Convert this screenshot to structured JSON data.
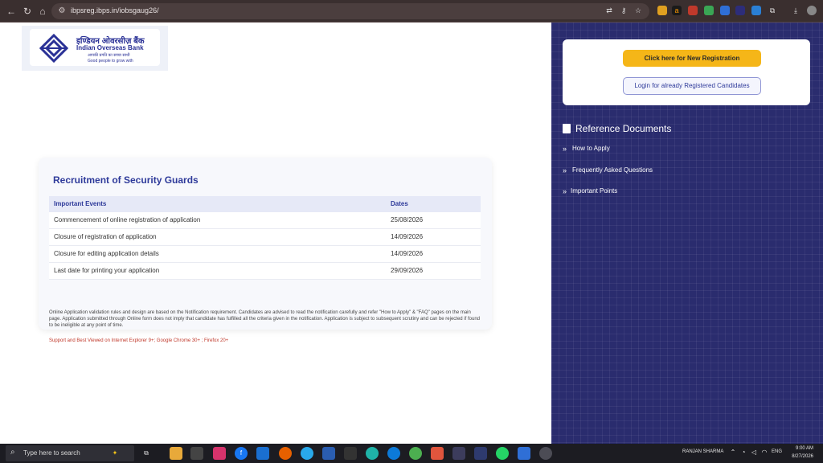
{
  "browser": {
    "url": "ibpsreg.ibps.in/iobsgaug26/",
    "nav_icons": [
      "back-icon",
      "reload-icon",
      "home-icon"
    ]
  },
  "logo": {
    "hindi": "इण्डियन ओवरसीज़ बैंक",
    "english": "Indian Overseas Bank",
    "tagline_hindi": "आपकी प्रगति का सच्चा साथी",
    "tagline": "Good people to grow with",
    "brand_color": "#2a3196"
  },
  "main": {
    "title": "Recruitment of Security Guards",
    "table": {
      "headers": [
        "Important Events",
        "Dates"
      ],
      "rows": [
        [
          "Commencement of online registration of application",
          "25/08/2026"
        ],
        [
          "Closure of registration of application",
          "14/09/2026"
        ],
        [
          "Closure for editing application details",
          "14/09/2026"
        ],
        [
          "Last date for printing your application",
          "29/09/2026"
        ]
      ]
    },
    "note": "Online Application validation rules and design are based on the Notification requirement. Candidates are advised to read the notification carefully and refer \"How to Apply\" & \"FAQ\" pages on the main page. Application submitted through Online form does not imply that candidate has fulfilled all the criteria given in the notification. Application is subject to subsequent scrutiny and can be rejected if found to be ineligible at any point of time.",
    "support": "Support and Best Viewed on Internet Explorer 9+; Google Chrome 30+ ; Firefox 20+"
  },
  "sidebar": {
    "new_registration": "Click here for New Registration",
    "login": "Login for already Registered Candidates",
    "reference_title": "Reference Documents",
    "items": [
      {
        "label": "How to Apply"
      },
      {
        "label": "Frequently Asked Questions"
      },
      {
        "label": "Important Points"
      }
    ],
    "accent": "#f5b618",
    "panel_color": "#2a2c6e"
  },
  "taskbar": {
    "search_placeholder": "Type here to search",
    "user": "RANJAN SHARMA",
    "language": "ENG",
    "time": "9:00 AM",
    "date": "8/27/2026"
  }
}
